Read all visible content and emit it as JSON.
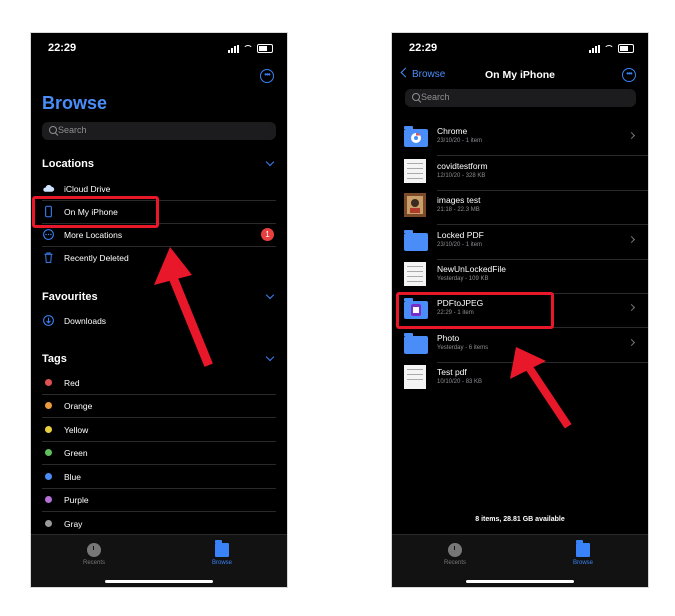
{
  "left": {
    "status_time": "22:29",
    "title": "Browse",
    "search_placeholder": "Search",
    "locations_header": "Locations",
    "locations": [
      {
        "label": "iCloud Drive",
        "icon": "cloud-icon"
      },
      {
        "label": "On My iPhone",
        "icon": "iphone-icon"
      },
      {
        "label": "More Locations",
        "icon": "ellipsis-circle-icon",
        "badge": "1"
      },
      {
        "label": "Recently Deleted",
        "icon": "trash-icon"
      }
    ],
    "favourites_header": "Favourites",
    "favourites": [
      {
        "label": "Downloads",
        "icon": "download-circle-icon"
      }
    ],
    "tags_header": "Tags",
    "tags": [
      {
        "label": "Red",
        "color": "#e0524f"
      },
      {
        "label": "Orange",
        "color": "#e99a3f"
      },
      {
        "label": "Yellow",
        "color": "#e8cf3f"
      },
      {
        "label": "Green",
        "color": "#5ec15e"
      },
      {
        "label": "Blue",
        "color": "#4a8df8"
      },
      {
        "label": "Purple",
        "color": "#b470d6"
      },
      {
        "label": "Gray",
        "color": "#9a9a9a"
      }
    ],
    "tabs": [
      {
        "label": "Recents"
      },
      {
        "label": "Browse"
      }
    ]
  },
  "right": {
    "status_time": "22:29",
    "back_label": "Browse",
    "nav_title": "On My iPhone",
    "search_placeholder": "Search",
    "files": [
      {
        "name": "Chrome",
        "meta": "23/10/20 - 1 item",
        "kind": "chrome-folder"
      },
      {
        "name": "covidtestform",
        "meta": "12/10/20 - 328 KB",
        "kind": "doc"
      },
      {
        "name": "images test",
        "meta": "21:18 - 22.3 MB",
        "kind": "image"
      },
      {
        "name": "Locked PDF",
        "meta": "23/10/20 - 1 item",
        "kind": "folder"
      },
      {
        "name": "NewUnLockedFile",
        "meta": "Yesterday - 109 KB",
        "kind": "doc"
      },
      {
        "name": "PDFtoJPEG",
        "meta": "22:29 - 1 item",
        "kind": "app-folder"
      },
      {
        "name": "Photo",
        "meta": "Yesterday - 6 items",
        "kind": "folder"
      },
      {
        "name": "Test pdf",
        "meta": "10/10/20 - 83 KB",
        "kind": "doc"
      }
    ],
    "footer": "8 items, 28.81 GB available",
    "tabs": [
      {
        "label": "Recents"
      },
      {
        "label": "Browse"
      }
    ]
  },
  "colors": {
    "accent": "#3a82f7",
    "highlight": "#e8182a",
    "background": "#000000"
  }
}
